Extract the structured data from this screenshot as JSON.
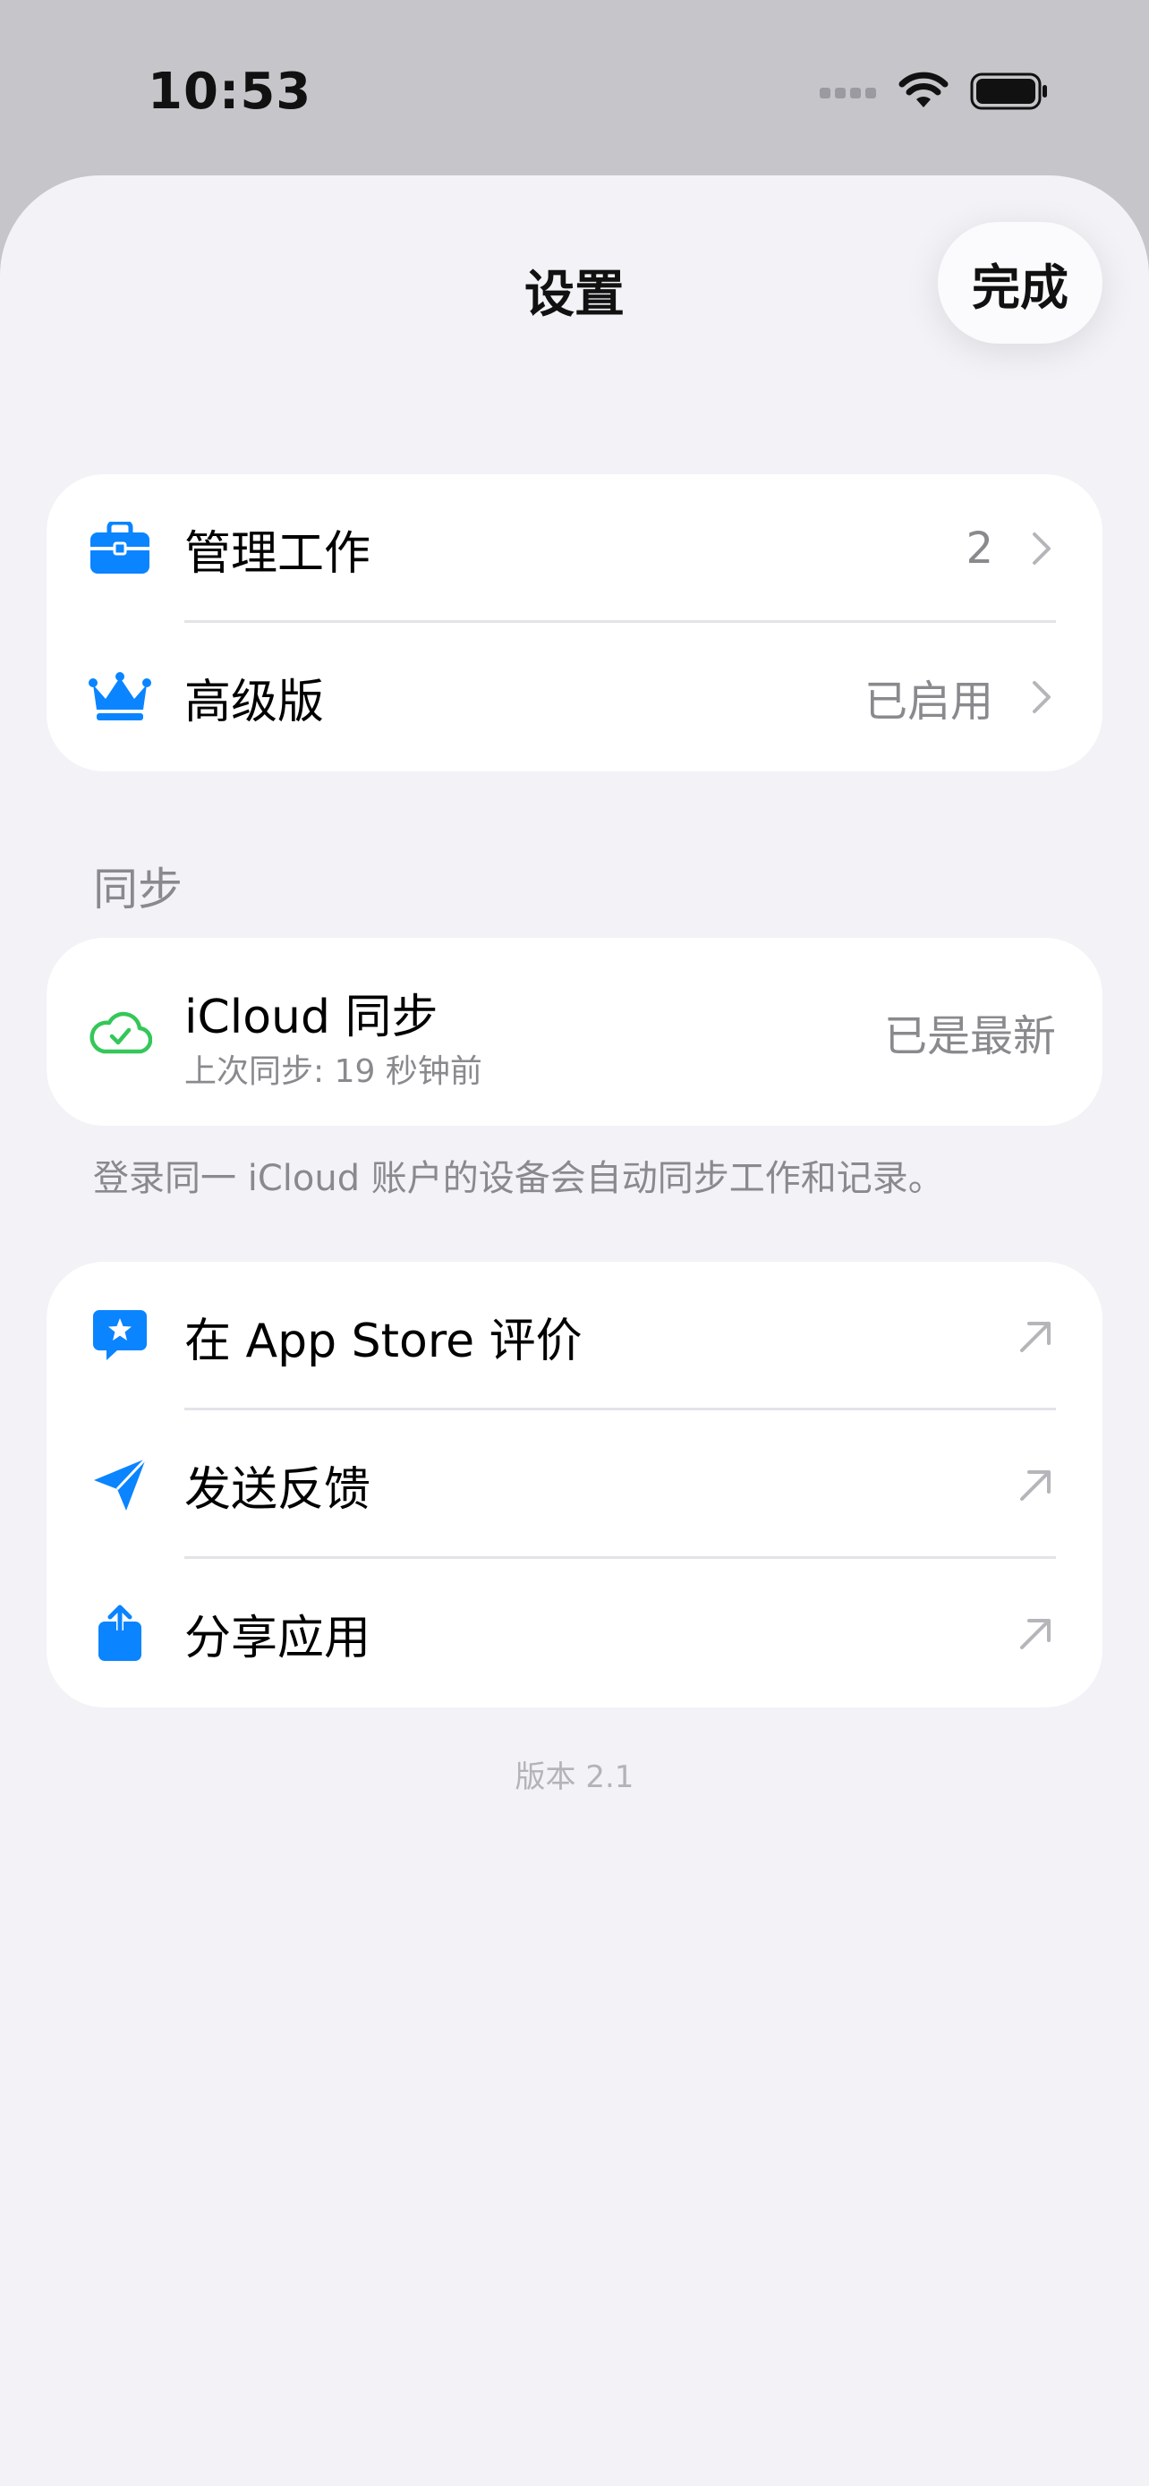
{
  "status_bar": {
    "time": "10:53"
  },
  "sheet": {
    "title": "设置",
    "done_label": "完成"
  },
  "group1": {
    "items": [
      {
        "label": "管理工作",
        "value": "2",
        "icon": "briefcase-icon"
      },
      {
        "label": "高级版",
        "value": "已启用",
        "icon": "crown-icon"
      }
    ]
  },
  "sync": {
    "header": "同步",
    "title": "iCloud 同步",
    "subtitle": "上次同步: 19 秒钟前",
    "status": "已是最新",
    "icon": "cloud-check-icon",
    "footnote": "登录同一 iCloud 账户的设备会自动同步工作和记录。"
  },
  "group3": {
    "items": [
      {
        "label": "在 App Store 评价",
        "icon": "star-bubble-icon"
      },
      {
        "label": "发送反馈",
        "icon": "paperplane-icon"
      },
      {
        "label": "分享应用",
        "icon": "share-icon"
      }
    ]
  },
  "version": "版本 2.1",
  "colors": {
    "accent": "#0a84ff",
    "sync_green": "#34c759",
    "background": "#f2f2f7",
    "secondary_text": "#8a8a8e"
  }
}
